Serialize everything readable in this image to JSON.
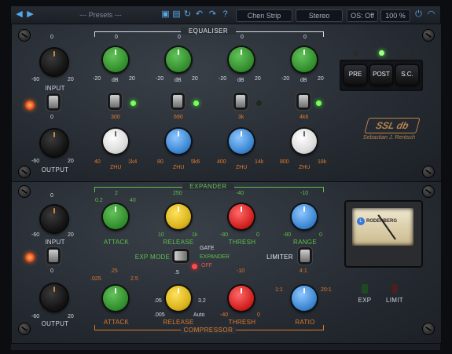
{
  "toolbar": {
    "presets_label": "--- Presets ---",
    "preset_name": "Chen Strip",
    "mode": "Stereo",
    "os": "OS: Off",
    "zoom": "100 %"
  },
  "eq": {
    "section_title": "EQUALISER",
    "bands": [
      {
        "gain_top": "0",
        "gain_left": "-20",
        "gain_unit": "dB",
        "gain_right": "20",
        "freq_top": "300",
        "freq_left": "40",
        "freq_unit": "ZHU",
        "freq_right": "1k4"
      },
      {
        "gain_top": "0",
        "gain_left": "-20",
        "gain_unit": "dB",
        "gain_right": "20",
        "freq_top": "690",
        "freq_left": "80",
        "freq_unit": "ZHU",
        "freq_right": "5k6"
      },
      {
        "gain_top": "0",
        "gain_left": "-20",
        "gain_unit": "dB",
        "gain_right": "20",
        "freq_top": "3k",
        "freq_left": "400",
        "freq_unit": "ZHU",
        "freq_right": "14k"
      },
      {
        "gain_top": "0",
        "gain_left": "-20",
        "gain_unit": "dB",
        "gain_right": "20",
        "freq_top": "4k6",
        "freq_left": "800",
        "freq_unit": "ZHU",
        "freq_right": "18k"
      }
    ],
    "buttons": [
      "PRE",
      "POST",
      "S.C."
    ]
  },
  "io_top": {
    "input_label": "INPUT",
    "output_label": "OUTPUT",
    "top": "0",
    "left": "-60",
    "right": "20"
  },
  "io_bottom": {
    "input_label": "INPUT",
    "output_label": "OUTPUT",
    "top": "0",
    "left": "-60",
    "right": "20"
  },
  "expander": {
    "section_title": "EXPANDER",
    "attack": {
      "label": "ATTACK",
      "top": "2",
      "left": "0.2",
      "right": "40"
    },
    "release": {
      "label": "RELEASE",
      "top": "250",
      "left": "10",
      "right": "1k"
    },
    "thresh": {
      "label": "THRESH",
      "top": "-40",
      "left": "-80",
      "right": "0"
    },
    "range": {
      "label": "RANGE",
      "top": "-10",
      "left": "-80",
      "right": "0"
    }
  },
  "modes": {
    "exp_mode": "EXP MODE",
    "gate": "GATE",
    "expander": "EXPANDER",
    "off": "OFF",
    "limiter": "LIMITER"
  },
  "compressor": {
    "section_title": "COMPRESSOR",
    "attack": {
      "label": "ATTACK",
      "top": ".25",
      "left": ".025",
      "right": "2.5"
    },
    "release": {
      "label": "RELEASE",
      "top": ".5",
      "left": ".05",
      "right": "3.2"
    },
    "thresh": {
      "label": "THRESH",
      "top": "-10",
      "left": "-40",
      "right": "0"
    },
    "ratio": {
      "label": "RATIO",
      "top": "4:1",
      "left": "1:1",
      "right": "20:1"
    },
    "release_auto": "Auto",
    "release_min": ".005"
  },
  "meter": {
    "brand": "RODENBERG",
    "bottom_left": "EXP",
    "bottom_right": "LIMIT"
  },
  "logo": {
    "text": "SSL db",
    "sub": "Sebastian J. Rentsch"
  }
}
